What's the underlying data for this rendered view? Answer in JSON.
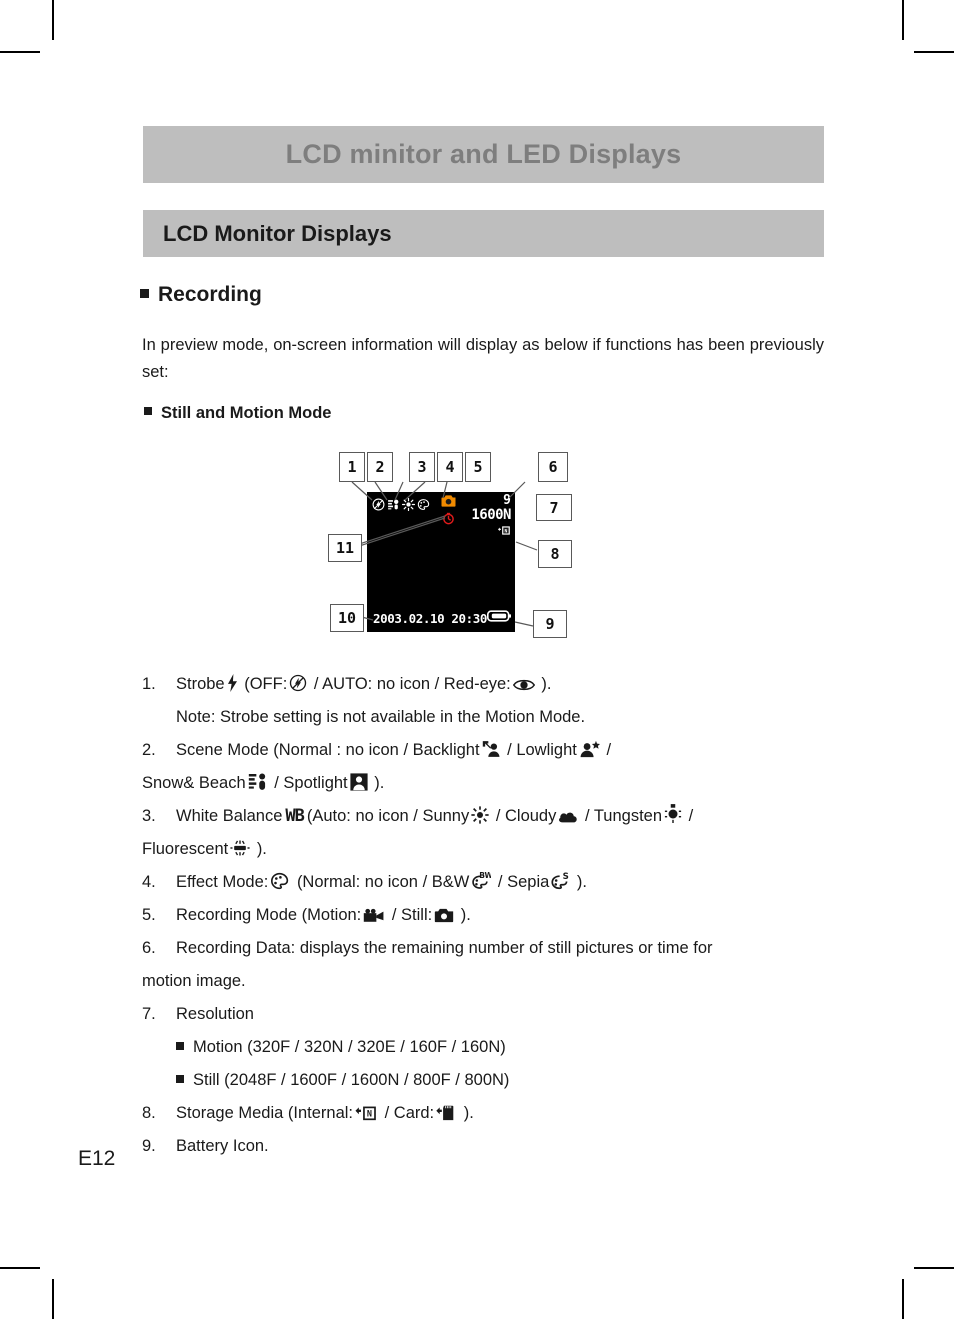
{
  "page": {
    "number": "E12",
    "title": "LCD minitor and LED Displays",
    "subtitle": "LCD Monitor Displays",
    "bar_color": "#BEBEBE",
    "title_color": "#7E7E7E"
  },
  "sections": {
    "recording_heading": "Recording",
    "intro": "In preview mode, on-screen information will display as below if functions has been previously set:",
    "still_motion_heading": "Still and Motion Mode"
  },
  "figure": {
    "name": "lcd-monitor-diagram",
    "screen": {
      "count": "9",
      "resolution": "1600N",
      "date": "2003.02.10",
      "time": "20:30",
      "icons": [
        "strobe-off-icon",
        "scene-mode-icon",
        "white-balance-icon",
        "effect-mode-icon",
        "recording-mode-still-icon",
        "self-timer-icon",
        "storage-media-icon",
        "battery-icon"
      ]
    },
    "callouts": [
      "1",
      "2",
      "3",
      "4",
      "5",
      "6",
      "7",
      "8",
      "9",
      "10",
      "11"
    ]
  },
  "list": [
    {
      "num": "1.",
      "pre": "Strobe",
      "icon": "strobe-icon",
      "parts": [
        "(OFF:",
        "strobe-off-icon",
        "/ AUTO: no icon / Red-eye:",
        "red-eye-icon",
        ")."
      ],
      "note": "Note: Strobe setting is not available in the Motion Mode."
    },
    {
      "num": "2.",
      "line1": "Scene Mode (Normal : no icon / Backlight",
      "icon1": "backlight-icon",
      "line1b": "/ Lowlight",
      "icon2": "lowlight-icon",
      "line1c": "/",
      "line2": "Snow& Beach",
      "icon3": "snow-beach-icon",
      "line2b": "/ Spotlight",
      "icon4": "spotlight-icon",
      "line2c": ")."
    },
    {
      "num": "3.",
      "line1": "White Balance",
      "wb": "WB",
      "line1b": "(Auto: no icon / Sunny",
      "icon1": "sunny-icon",
      "line1c": "/ Cloudy",
      "icon2": "cloudy-icon",
      "line1d": "/ Tungsten",
      "icon3": "tungsten-icon",
      "line1e": "/",
      "line2": "Fluorescent",
      "icon4": "fluorescent-icon",
      "line2b": ")."
    },
    {
      "num": "4.",
      "line1": "Effect Mode:",
      "icon1": "effect-mode-icon",
      "line1b": "(Normal: no icon / B&W",
      "icon2": "bw-effect-icon",
      "line1c": "/ Sepia",
      "icon3": "sepia-effect-icon",
      "line1d": ")."
    },
    {
      "num": "5.",
      "line1": "Recording Mode (Motion:",
      "icon1": "motion-camera-icon",
      "line1b": "/ Still:",
      "icon2": "still-camera-icon",
      "line1c": ")."
    },
    {
      "num": "6.",
      "line1": "Recording Data: displays the remaining number of still pictures or time for",
      "line2": "motion image."
    },
    {
      "num": "7.",
      "line1": "Resolution",
      "sub": [
        "Motion (320F / 320N / 320E / 160F / 160N)",
        "Still (2048F / 1600F / 1600N / 800F / 800N)"
      ]
    },
    {
      "num": "8.",
      "line1": "Storage Media (Internal:",
      "icon1": "internal-memory-icon",
      "line1b": "/ Card:",
      "icon2": "memory-card-icon",
      "line1c": ")."
    },
    {
      "num": "9.",
      "line1": "Battery Icon."
    }
  ]
}
